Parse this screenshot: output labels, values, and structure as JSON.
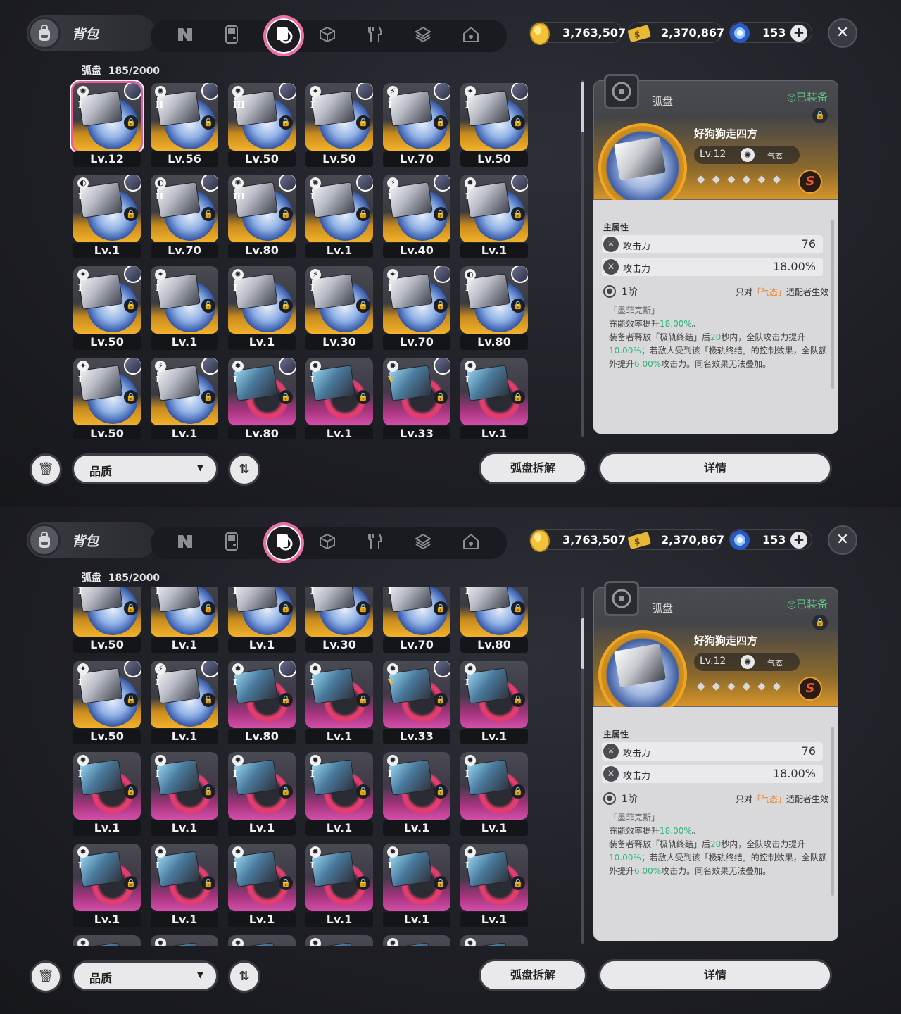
{
  "header": {
    "bag_title": "背包",
    "tabs": [
      {
        "icon": "n-logo-icon",
        "active": false
      },
      {
        "icon": "gameboy-icon",
        "active": false
      },
      {
        "icon": "disc-case-icon",
        "active": true
      },
      {
        "icon": "cube-icon",
        "active": false
      },
      {
        "icon": "fork-knife-icon",
        "active": false
      },
      {
        "icon": "layered-cube-icon",
        "active": false
      },
      {
        "icon": "home-icon",
        "active": false
      }
    ],
    "currencies": [
      {
        "name": "gold-coin",
        "value": "3,763,507"
      },
      {
        "name": "ticket",
        "value": "2,370,867"
      },
      {
        "name": "blue-crystal",
        "value": "153",
        "has_plus": true
      }
    ],
    "close_label": "✕"
  },
  "inventory": {
    "category": "弧盘",
    "count": "185/2000",
    "cards": [
      {
        "lv": "Lv.12",
        "phase": "I",
        "rank": "S",
        "attr": "✺",
        "selected": true,
        "avatar": true
      },
      {
        "lv": "Lv.56",
        "phase": "II",
        "rank": "S",
        "attr": "✺",
        "avatar": true
      },
      {
        "lv": "Lv.50",
        "phase": "III",
        "rank": "S",
        "attr": "✹",
        "avatar": true
      },
      {
        "lv": "Lv.50",
        "phase": "I",
        "rank": "S",
        "attr": "✦",
        "avatar": true
      },
      {
        "lv": "Lv.70",
        "phase": "I",
        "rank": "S",
        "attr": "⚡",
        "avatar": true
      },
      {
        "lv": "Lv.50",
        "phase": "I",
        "rank": "S",
        "attr": "✦",
        "avatar": true
      },
      {
        "lv": "Lv.1",
        "phase": "I",
        "rank": "S",
        "attr": "◐",
        "avatar": true
      },
      {
        "lv": "Lv.70",
        "phase": "II",
        "rank": "S",
        "attr": "◐",
        "avatar": true
      },
      {
        "lv": "Lv.80",
        "phase": "III",
        "rank": "S",
        "attr": "✺",
        "avatar": true
      },
      {
        "lv": "Lv.1",
        "phase": "I",
        "rank": "S",
        "attr": "✺",
        "avatar": true
      },
      {
        "lv": "Lv.40",
        "phase": "I",
        "rank": "S",
        "attr": "⚡",
        "avatar": true
      },
      {
        "lv": "Lv.1",
        "phase": "I",
        "rank": "S",
        "attr": "✹",
        "avatar": true
      },
      {
        "lv": "Lv.50",
        "phase": "I",
        "rank": "S",
        "attr": "✦",
        "avatar": true
      },
      {
        "lv": "Lv.1",
        "phase": "I",
        "rank": "S",
        "attr": "✦",
        "avatar": false
      },
      {
        "lv": "Lv.1",
        "phase": "I",
        "rank": "S",
        "attr": "✺",
        "avatar": false
      },
      {
        "lv": "Lv.30",
        "phase": "I",
        "rank": "S",
        "attr": "⚡",
        "avatar": false
      },
      {
        "lv": "Lv.70",
        "phase": "I",
        "rank": "S",
        "attr": "✦",
        "avatar": true
      },
      {
        "lv": "Lv.80",
        "phase": "I",
        "rank": "S",
        "attr": "◐",
        "avatar": true
      },
      {
        "lv": "Lv.50",
        "phase": "I",
        "rank": "S",
        "attr": "✦",
        "avatar": true
      },
      {
        "lv": "Lv.1",
        "phase": "I",
        "rank": "S",
        "attr": "⚡",
        "avatar": true
      },
      {
        "lv": "Lv.80",
        "phase": "I",
        "rank": "A",
        "attr": "✹",
        "avatar": true
      },
      {
        "lv": "Lv.1",
        "phase": "I",
        "rank": "A",
        "attr": "✹",
        "avatar": false
      },
      {
        "lv": "Lv.33",
        "phase": "V",
        "rank": "A",
        "attr": "✹",
        "avatar": true
      },
      {
        "lv": "Lv.1",
        "phase": "I",
        "rank": "A",
        "attr": "✹",
        "avatar": false
      },
      {
        "lv": "Lv.1",
        "phase": "I",
        "rank": "A",
        "attr": "✹",
        "avatar": false
      },
      {
        "lv": "Lv.1",
        "phase": "I",
        "rank": "A",
        "attr": "✹",
        "avatar": false
      },
      {
        "lv": "Lv.1",
        "phase": "I",
        "rank": "A",
        "attr": "✹",
        "avatar": false
      },
      {
        "lv": "Lv.1",
        "phase": "I",
        "rank": "A",
        "attr": "✹",
        "avatar": false
      },
      {
        "lv": "Lv.1",
        "phase": "I",
        "rank": "A",
        "attr": "✹",
        "avatar": false
      },
      {
        "lv": "Lv.1",
        "phase": "I",
        "rank": "A",
        "attr": "✹",
        "avatar": false
      },
      {
        "lv": "Lv.1",
        "phase": "I",
        "rank": "A",
        "attr": "✹",
        "avatar": false
      },
      {
        "lv": "Lv.1",
        "phase": "I",
        "rank": "A",
        "attr": "✹",
        "avatar": false
      },
      {
        "lv": "Lv.1",
        "phase": "I",
        "rank": "A",
        "attr": "✹",
        "avatar": false
      },
      {
        "lv": "Lv.1",
        "phase": "I",
        "rank": "A",
        "attr": "✹",
        "avatar": false
      },
      {
        "lv": "Lv.1",
        "phase": "I",
        "rank": "A",
        "attr": "✹",
        "avatar": false
      },
      {
        "lv": "Lv.1",
        "phase": "I",
        "rank": "A",
        "attr": "✹",
        "avatar": false
      },
      {
        "lv": "",
        "phase": "I",
        "rank": "A",
        "attr": "✹",
        "avatar": false
      },
      {
        "lv": "",
        "phase": "I",
        "rank": "A",
        "attr": "✹",
        "avatar": false
      },
      {
        "lv": "",
        "phase": "I",
        "rank": "A",
        "attr": "✹",
        "avatar": false
      },
      {
        "lv": "",
        "phase": "I",
        "rank": "A",
        "attr": "✹",
        "avatar": false
      },
      {
        "lv": "",
        "phase": "I",
        "rank": "A",
        "attr": "✹",
        "avatar": false
      },
      {
        "lv": "",
        "phase": "I",
        "rank": "A",
        "attr": "✹",
        "avatar": false
      }
    ]
  },
  "detail": {
    "category": "弧盘",
    "equipped_label": "◎已装备",
    "name": "好狗狗走四方",
    "level": "Lv.12",
    "attribute": "气态",
    "stars": "◆◆◆◆◆◆",
    "rank": "S",
    "main_attr_title": "主属性",
    "stats": [
      {
        "name": "攻击力",
        "value": "76"
      },
      {
        "name": "攻击力",
        "value": "18.00%"
      }
    ],
    "passive": {
      "tier": "1阶",
      "condition_prefix": "只对",
      "condition_attr": "「气态」",
      "condition_suffix": "适配者生效",
      "title": "「墨菲克斯」",
      "line1_prefix": "充能效率提升",
      "line1_value": "18.00%",
      "line1_suffix": "。",
      "line2_a": "装备者释放「极轨终结」后",
      "line2_sec": "20",
      "line2_b": "秒内，全队攻击力提升",
      "line2_val": "10.00%",
      "line2_c": "；若敌人受到该「极轨终结」的控制效果，全队额外提升",
      "line2_val2": "6.00%",
      "line2_d": "攻击力。同名效果无法叠加。"
    }
  },
  "bottom": {
    "quality_label": "品质",
    "dismantle_label": "弧盘拆解",
    "details_label": "详情"
  }
}
